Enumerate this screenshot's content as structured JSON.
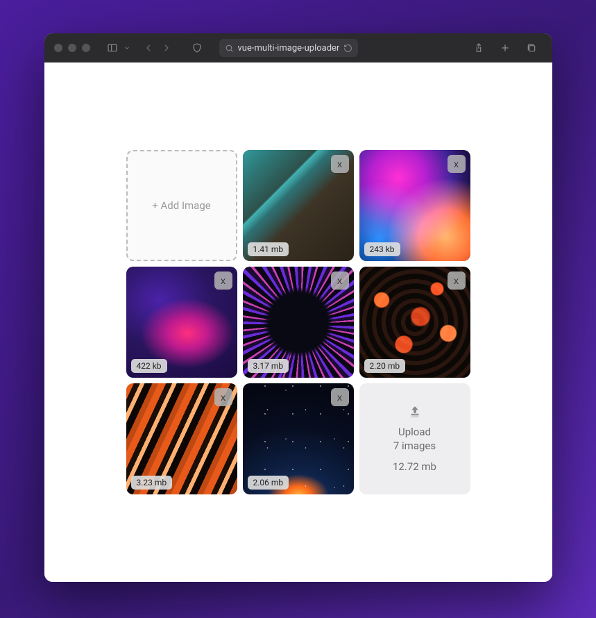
{
  "browser": {
    "url": "vue-multi-image-uploader"
  },
  "uploader": {
    "add_label": "+ Add Image",
    "remove_label": "x",
    "images": [
      {
        "size": "1.41 mb"
      },
      {
        "size": "243 kb"
      },
      {
        "size": "422 kb"
      },
      {
        "size": "3.17 mb"
      },
      {
        "size": "2.20 mb"
      },
      {
        "size": "3.23 mb"
      },
      {
        "size": "2.06 mb"
      }
    ],
    "summary": {
      "line1": "Upload",
      "line2": "7 images",
      "total": "12.72 mb"
    }
  }
}
